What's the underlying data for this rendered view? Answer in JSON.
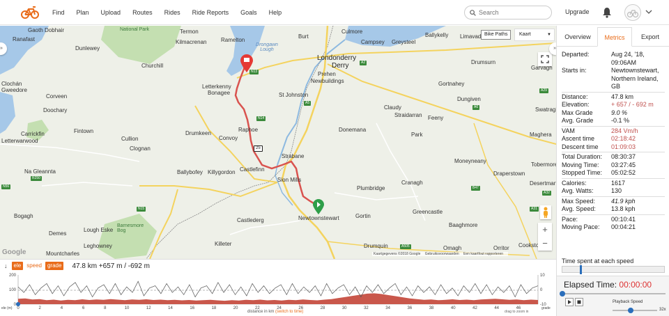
{
  "nav": {
    "links": [
      "Find",
      "Plan",
      "Upload",
      "Routes",
      "Rides",
      "Ride Reports",
      "Goals",
      "Help"
    ],
    "search_placeholder": "Search",
    "upgrade": "Upgrade"
  },
  "map": {
    "bike_paths": "Bike Paths",
    "layer": "Kaart",
    "zoom_in": "+",
    "zoom_out": "−",
    "google": "Google",
    "attribution": [
      "Kaartgegevens ©2018 Google",
      "Gebruiksvoorwaarden",
      "Een kaartfout rapporteren"
    ],
    "labels": [
      {
        "text": "Gaoth Dobhair",
        "kind": "town"
      },
      {
        "text": "Ranafast",
        "kind": "town"
      },
      {
        "text": "Dunlewey",
        "kind": "town"
      },
      {
        "text": "National Park",
        "kind": "green"
      },
      {
        "text": "Termon",
        "kind": "town"
      },
      {
        "text": "Kilmacrenan",
        "kind": "town"
      },
      {
        "text": "Ramelton",
        "kind": "town"
      },
      {
        "text": "Drongawn Lough",
        "kind": "water"
      },
      {
        "text": "Burt",
        "kind": "town"
      },
      {
        "text": "Culmore",
        "kind": "town"
      },
      {
        "text": "Campsey",
        "kind": "town"
      },
      {
        "text": "Greysteel",
        "kind": "town"
      },
      {
        "text": "Ballykelly",
        "kind": "town"
      },
      {
        "text": "Limavady",
        "kind": "town"
      },
      {
        "text": "Londonderry",
        "kind": "city"
      },
      {
        "text": "Derry",
        "kind": "city"
      },
      {
        "text": "Churchill",
        "kind": "town"
      },
      {
        "text": "Letterkenny",
        "kind": "town"
      },
      {
        "text": "Bonagee",
        "kind": "town"
      },
      {
        "text": "Prehen",
        "kind": "town"
      },
      {
        "text": "Newbuildings",
        "kind": "town"
      },
      {
        "text": "Drumsurn",
        "kind": "town"
      },
      {
        "text": "Garvagh",
        "kind": "town"
      },
      {
        "text": "Clochán",
        "kind": "town"
      },
      {
        "text": "Gweedore",
        "kind": "town"
      },
      {
        "text": "Corveen",
        "kind": "town"
      },
      {
        "text": "Doochary",
        "kind": "town"
      },
      {
        "text": "St Johnston",
        "kind": "town"
      },
      {
        "text": "Claudy",
        "kind": "town"
      },
      {
        "text": "Straidarran",
        "kind": "town"
      },
      {
        "text": "Feeny",
        "kind": "town"
      },
      {
        "text": "Gortnahey",
        "kind": "town"
      },
      {
        "text": "Dungiven",
        "kind": "town"
      },
      {
        "text": "Swatragh",
        "kind": "town"
      },
      {
        "text": "Carrickfin",
        "kind": "town"
      },
      {
        "text": "Letterwarwood",
        "kind": "town"
      },
      {
        "text": "Fintown",
        "kind": "town"
      },
      {
        "text": "Raphoe",
        "kind": "town"
      },
      {
        "text": "Drumkeen",
        "kind": "town"
      },
      {
        "text": "Convoy",
        "kind": "town"
      },
      {
        "text": "Cullion",
        "kind": "town"
      },
      {
        "text": "Clognan",
        "kind": "town"
      },
      {
        "text": "Donemana",
        "kind": "town"
      },
      {
        "text": "Park",
        "kind": "town"
      },
      {
        "text": "Maghera",
        "kind": "town"
      },
      {
        "text": "Strabane",
        "kind": "town"
      },
      {
        "text": "Castlefinn",
        "kind": "town"
      },
      {
        "text": "Ballybofey",
        "kind": "town"
      },
      {
        "text": "Killygordon",
        "kind": "town"
      },
      {
        "text": "Moneyneany",
        "kind": "town"
      },
      {
        "text": "Draperstown",
        "kind": "town"
      },
      {
        "text": "Tobermore",
        "kind": "town"
      },
      {
        "text": "Na Gleannta",
        "kind": "town"
      },
      {
        "text": "Sion Mills",
        "kind": "town"
      },
      {
        "text": "Plumbridge",
        "kind": "town"
      },
      {
        "text": "Cranagh",
        "kind": "town"
      },
      {
        "text": "Desertmartin",
        "kind": "town"
      },
      {
        "text": "Bogagh",
        "kind": "town"
      },
      {
        "text": "Newtownstewart",
        "kind": "town"
      },
      {
        "text": "Gortin",
        "kind": "town"
      },
      {
        "text": "Castlederg",
        "kind": "town"
      },
      {
        "text": "Greencastle",
        "kind": "town"
      },
      {
        "text": "Baaghmore",
        "kind": "town"
      },
      {
        "text": "Lough Eske",
        "kind": "town"
      },
      {
        "text": "Barnesmore Bog",
        "kind": "green"
      },
      {
        "text": "Drumquin",
        "kind": "town"
      },
      {
        "text": "Killeter",
        "kind": "town"
      },
      {
        "text": "Leghowney",
        "kind": "town"
      },
      {
        "text": "Mountcharles",
        "kind": "town"
      },
      {
        "text": "Omagh",
        "kind": "town"
      },
      {
        "text": "Cookstown",
        "kind": "town"
      },
      {
        "text": "Orritor",
        "kind": "town"
      },
      {
        "text": "Demes",
        "kind": "town"
      }
    ],
    "road_numbers": [
      "N13",
      "N14",
      "A5",
      "A2",
      "A6",
      "N15",
      "N56",
      "R250",
      "A505",
      "A29",
      "A31",
      "A32",
      "B47",
      "25"
    ]
  },
  "elevation": {
    "toggles": [
      "ele",
      "speed",
      "grade"
    ],
    "active": "ele",
    "summary": "47.8 km +657 m / -692 m",
    "y_left_ticks": [
      "200",
      "100",
      "0"
    ],
    "y_right_ticks": [
      "10",
      "0",
      "-10"
    ],
    "x_ticks": [
      "0",
      "2",
      "4",
      "6",
      "8",
      "10",
      "12",
      "14",
      "16",
      "18",
      "20",
      "22",
      "24",
      "26",
      "28",
      "30",
      "32",
      "34",
      "36",
      "38",
      "40",
      "42",
      "44",
      "46"
    ],
    "left_axis_label": "ele (m)",
    "right_axis_label": "grade",
    "x_label_prefix": "distance in km",
    "x_label_link": "(switch to time)",
    "hint": "drag to zoom in"
  },
  "panel": {
    "tabs": [
      "Overview",
      "Metrics",
      "Export"
    ],
    "active_tab": "Metrics",
    "departed_label": "Departed:",
    "departed_value": "Aug 24, '18, 09:06AM",
    "starts_label": "Starts in:",
    "starts_value": "Newtownstewart, Northern Ireland, GB",
    "group1": [
      {
        "k": "Distance:",
        "v": "47.8 km"
      },
      {
        "k": "Elevation:",
        "v": "+ 657 / - 692 m",
        "style": "red"
      },
      {
        "k": "Max Grade",
        "v": "9.0 %",
        "style": "it"
      },
      {
        "k": "Avg. Grade",
        "v": "-0.1 %"
      }
    ],
    "group2": [
      {
        "k": "VAM",
        "v": "284 Vm/h",
        "style": "red"
      },
      {
        "k": "Ascent time",
        "v": "02:18:42",
        "style": "red"
      },
      {
        "k": "Descent time",
        "v": "01:09:03",
        "style": "red"
      }
    ],
    "group3": [
      {
        "k": "Total Duration:",
        "v": "08:30:37"
      },
      {
        "k": "Moving Time:",
        "v": "03:27:45"
      },
      {
        "k": "Stopped Time:",
        "v": "05:02:52"
      }
    ],
    "group4": [
      {
        "k": "Calories:",
        "v": "1617"
      },
      {
        "k": "Avg. Watts:",
        "v": "130"
      }
    ],
    "group5": [
      {
        "k": "Max Speed:",
        "v": "41.9 kph",
        "style": "it"
      },
      {
        "k": "Avg. Speed:",
        "v": "13.8 kph"
      }
    ],
    "group6": [
      {
        "k": "Pace:",
        "v": "00:10:41"
      },
      {
        "k": "Moving Pace:",
        "v": "00:04:21"
      }
    ],
    "time_spent_label": "Time spent at each speed",
    "elapsed_label": "Elapsed Time:",
    "elapsed_value": "00:00:00",
    "playback_label": "Playback Speed",
    "playback_value": "32x"
  },
  "colors": {
    "accent": "#e96c1a",
    "route": "#d9534f",
    "elevation_fill": "#c9574b",
    "water": "#a6c8e8",
    "green": "#c4dfb1"
  },
  "icons": [
    "logo-icon",
    "search-icon",
    "bell-icon",
    "avatar-icon",
    "chevron-down-icon",
    "fullscreen-icon",
    "pegman-icon",
    "start-marker-icon",
    "end-marker-icon",
    "download-icon",
    "play-icon",
    "stop-icon"
  ]
}
